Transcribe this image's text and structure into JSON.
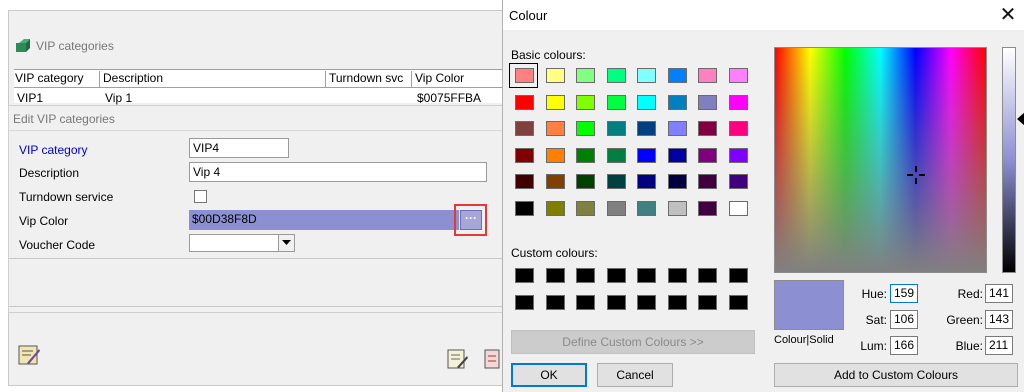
{
  "vip_window": {
    "title": "VIP categories",
    "columns": [
      "VIP category",
      "Description",
      "Turndown svc",
      "Vip Color"
    ],
    "row": {
      "category": "VIP1",
      "description": "Vip 1",
      "vip_color": "$0075FFBA"
    }
  },
  "edit_dialog": {
    "title": "Edit VIP categories",
    "fields": {
      "vip_category_label": "VIP category",
      "vip_category_value": "VIP4",
      "description_label": "Description",
      "description_value": "Vip 4",
      "turndown_label": "Turndown service",
      "turndown_checked": false,
      "vip_color_label": "Vip Color",
      "vip_color_value": "$00D38F8D",
      "voucher_label": "Voucher Code",
      "voucher_value": ""
    },
    "ellipsis_label": "···"
  },
  "colour_dialog": {
    "title": "Colour",
    "close_glyph": "✕",
    "basic_label": "Basic colours:",
    "custom_label": "Custom colours:",
    "basic_colours": [
      [
        "#ff8080",
        "#ffff80",
        "#80ff80",
        "#00ff80",
        "#80ffff",
        "#0080ff",
        "#ff80c0",
        "#ff80ff"
      ],
      [
        "#ff0000",
        "#ffff00",
        "#80ff00",
        "#00ff40",
        "#00ffff",
        "#0080c0",
        "#8080c0",
        "#ff00ff"
      ],
      [
        "#804040",
        "#ff8040",
        "#00ff00",
        "#008080",
        "#004080",
        "#8080ff",
        "#800040",
        "#ff0080"
      ],
      [
        "#800000",
        "#ff8000",
        "#008000",
        "#008040",
        "#0000ff",
        "#0000a0",
        "#800080",
        "#8000ff"
      ],
      [
        "#400000",
        "#804000",
        "#004000",
        "#004040",
        "#000080",
        "#000040",
        "#400040",
        "#400080"
      ],
      [
        "#000000",
        "#808000",
        "#808040",
        "#808080",
        "#408080",
        "#c0c0c0",
        "#400040",
        "#ffffff"
      ]
    ],
    "custom_colours": [
      [
        "#000000",
        "#000000",
        "#000000",
        "#000000",
        "#000000",
        "#000000",
        "#000000",
        "#000000"
      ],
      [
        "#000000",
        "#000000",
        "#000000",
        "#000000",
        "#000000",
        "#000000",
        "#000000",
        "#000000"
      ]
    ],
    "define_custom_label": "Define Custom Colours >>",
    "ok_label": "OK",
    "cancel_label": "Cancel",
    "preview_label": "Colour|Solid",
    "preview_colour": "#8d8fd3",
    "hue_label": "Hue:",
    "hue_value": "159",
    "sat_label": "Sat:",
    "sat_value": "106",
    "lum_label": "Lum:",
    "lum_value": "166",
    "red_label": "Red:",
    "red_value": "141",
    "green_label": "Green:",
    "green_value": "143",
    "blue_label": "Blue:",
    "blue_value": "211",
    "add_custom_label": "Add to Custom Colours"
  },
  "accent_colours": {
    "highlight": "#e03a3a",
    "selection": "#8d8fd3",
    "focus": "#0078d7"
  }
}
